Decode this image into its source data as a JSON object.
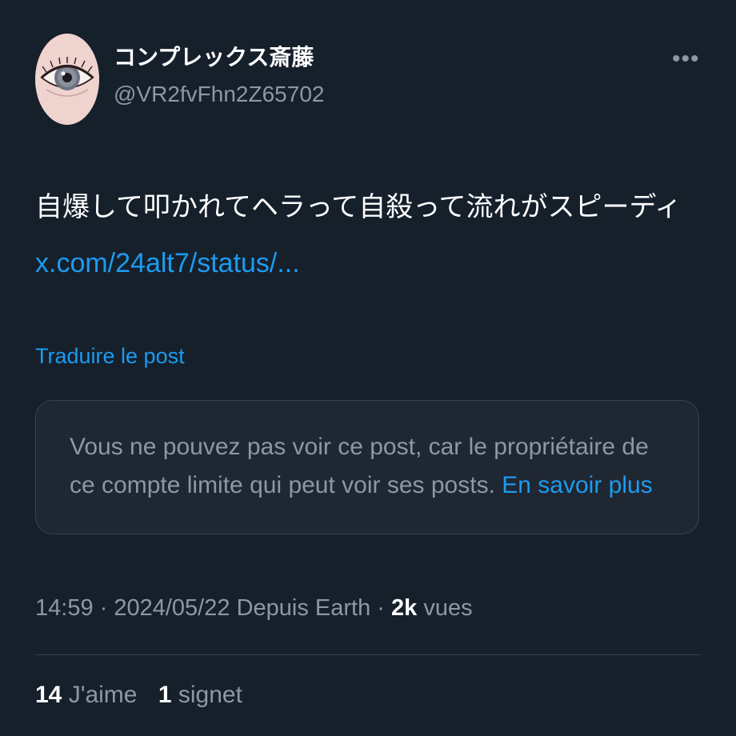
{
  "author": {
    "display_name": "コンプレックス斎藤",
    "handle": "@VR2fvFhn2Z65702"
  },
  "more_icon": "ellipsis-icon",
  "post": {
    "text": "自爆して叩かれてヘラって自殺って流れがスピーディ",
    "link": "x.com/24alt7/status/..."
  },
  "translate_label": "Traduire le post",
  "notice": {
    "text": "Vous ne pouvez pas voir ce post, car le propriétaire de ce compte limite qui peut voir ses posts.",
    "link": "En savoir plus"
  },
  "meta": {
    "time": "14:59",
    "date": "2024/05/22",
    "source": "Depuis Earth",
    "views_count": "2k",
    "views_label": "vues"
  },
  "stats": {
    "likes_count": "14",
    "likes_label": "J'aime",
    "bookmarks_count": "1",
    "bookmarks_label": "signet"
  },
  "colors": {
    "background": "#15202b",
    "accent": "#1d9bf0",
    "secondary_text": "#8b98a5",
    "border": "#38444d"
  }
}
